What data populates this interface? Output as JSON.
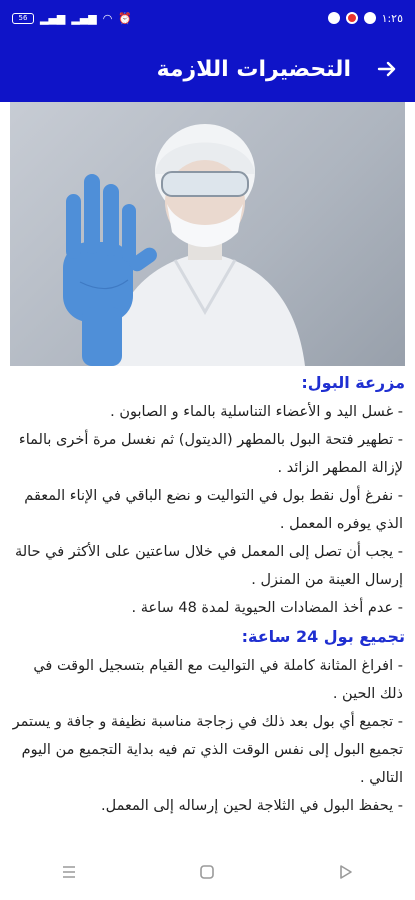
{
  "status_bar": {
    "time": "١:٢٥",
    "battery": "56"
  },
  "app_bar": {
    "title": "التحضيرات اللازمة"
  },
  "sections": [
    {
      "title": "مزرعة البول:",
      "items": [
        "- غسل اليد و الأعضاء التناسلية بالماء و الصابون .",
        "- تطهير فتحة البول بالمطهر (الديتول) ثم نغسل مرة أخرى بالماء لإزالة المطهر الزائد .",
        "- نفرغ أول نقط بول في التواليت و نضع الباقي في الإناء المعقم الذي يوفره المعمل .",
        "- يجب أن تصل إلى المعمل في خلال ساعتين على الأكثر في حالة إرسال العينة من المنزل .",
        "- عدم أخذ المضادات الحيوية لمدة 48 ساعة ."
      ]
    },
    {
      "title": "تجميع بول 24 ساعة:",
      "items": [
        "- افراغ المثانة كاملة في التواليت مع القيام بتسجيل الوقت في ذلك الحين .",
        "- تجميع أي بول بعد ذلك في زجاجة مناسبة نظيفة و جافة و يستمر تجميع البول إلى نفس الوقت الذي تم فيه بداية التجميع من اليوم التالي .",
        "- يحفظ البول في الثلاجة لحين إرساله إلى المعمل."
      ]
    }
  ]
}
